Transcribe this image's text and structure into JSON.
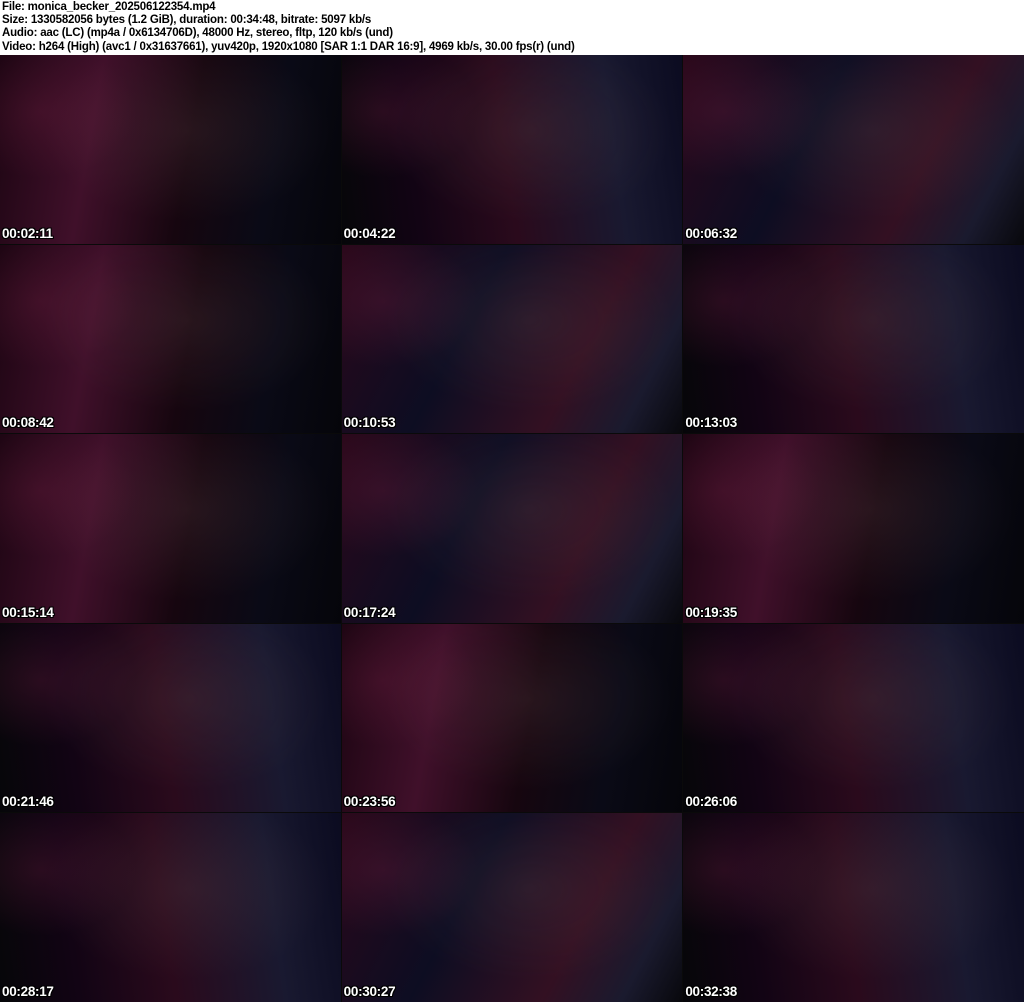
{
  "header": {
    "file_line": "File: monica_becker_202506122354.mp4",
    "size_line": "Size: 1330582056 bytes (1.2 GiB), duration: 00:34:48, bitrate: 5097 kb/s",
    "audio_line": "Audio: aac (LC) (mp4a / 0x6134706D), 48000 Hz, stereo, fltp, 120 kb/s (und)",
    "video_line": "Video: h264 (High) (avc1 / 0x31637661), yuv420p, 1920x1080 [SAR 1:1 DAR 16:9], 4969 kb/s, 30.00 fps(r) (und)"
  },
  "colors": {
    "page_background": "#ffffff",
    "header_text": "#000000",
    "timestamp_text": "#ffffff",
    "timestamp_outline": "#000000",
    "tile_dark_magenta": "#40102a",
    "tile_dark_navy": "#0b0b20",
    "tile_near_black": "#08080c"
  },
  "grid": {
    "columns": 3,
    "rows": 5
  },
  "thumbnails": [
    {
      "timestamp": "00:02:11",
      "variant": "a"
    },
    {
      "timestamp": "00:04:22",
      "variant": "b"
    },
    {
      "timestamp": "00:06:32",
      "variant": "c"
    },
    {
      "timestamp": "00:08:42",
      "variant": "a"
    },
    {
      "timestamp": "00:10:53",
      "variant": "c"
    },
    {
      "timestamp": "00:13:03",
      "variant": "b"
    },
    {
      "timestamp": "00:15:14",
      "variant": "a"
    },
    {
      "timestamp": "00:17:24",
      "variant": "c"
    },
    {
      "timestamp": "00:19:35",
      "variant": "a"
    },
    {
      "timestamp": "00:21:46",
      "variant": "b"
    },
    {
      "timestamp": "00:23:56",
      "variant": "a"
    },
    {
      "timestamp": "00:26:06",
      "variant": "b"
    },
    {
      "timestamp": "00:28:17",
      "variant": "b"
    },
    {
      "timestamp": "00:30:27",
      "variant": "c"
    },
    {
      "timestamp": "00:32:38",
      "variant": "b"
    }
  ]
}
